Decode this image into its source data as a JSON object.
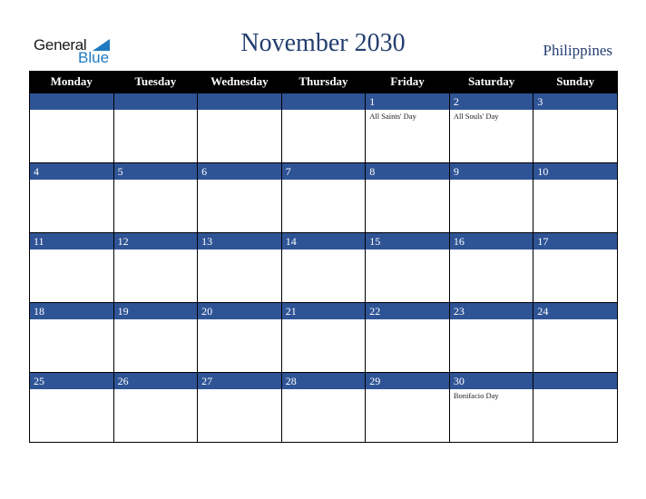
{
  "logo": {
    "general": "General",
    "blue": "Blue"
  },
  "header": {
    "title": "November 2030",
    "country": "Philippines"
  },
  "colors": {
    "band": "#2f5496",
    "header_bg": "#000000",
    "title": "#233e6f",
    "logo_blue": "#1f7ac0"
  },
  "weekdays": [
    "Monday",
    "Tuesday",
    "Wednesday",
    "Thursday",
    "Friday",
    "Saturday",
    "Sunday"
  ],
  "weeks": [
    [
      {
        "day": "",
        "holiday": ""
      },
      {
        "day": "",
        "holiday": ""
      },
      {
        "day": "",
        "holiday": ""
      },
      {
        "day": "",
        "holiday": ""
      },
      {
        "day": "1",
        "holiday": "All Saints' Day"
      },
      {
        "day": "2",
        "holiday": "All Souls' Day"
      },
      {
        "day": "3",
        "holiday": ""
      }
    ],
    [
      {
        "day": "4",
        "holiday": ""
      },
      {
        "day": "5",
        "holiday": ""
      },
      {
        "day": "6",
        "holiday": ""
      },
      {
        "day": "7",
        "holiday": ""
      },
      {
        "day": "8",
        "holiday": ""
      },
      {
        "day": "9",
        "holiday": ""
      },
      {
        "day": "10",
        "holiday": ""
      }
    ],
    [
      {
        "day": "11",
        "holiday": ""
      },
      {
        "day": "12",
        "holiday": ""
      },
      {
        "day": "13",
        "holiday": ""
      },
      {
        "day": "14",
        "holiday": ""
      },
      {
        "day": "15",
        "holiday": ""
      },
      {
        "day": "16",
        "holiday": ""
      },
      {
        "day": "17",
        "holiday": ""
      }
    ],
    [
      {
        "day": "18",
        "holiday": ""
      },
      {
        "day": "19",
        "holiday": ""
      },
      {
        "day": "20",
        "holiday": ""
      },
      {
        "day": "21",
        "holiday": ""
      },
      {
        "day": "22",
        "holiday": ""
      },
      {
        "day": "23",
        "holiday": ""
      },
      {
        "day": "24",
        "holiday": ""
      }
    ],
    [
      {
        "day": "25",
        "holiday": ""
      },
      {
        "day": "26",
        "holiday": ""
      },
      {
        "day": "27",
        "holiday": ""
      },
      {
        "day": "28",
        "holiday": ""
      },
      {
        "day": "29",
        "holiday": ""
      },
      {
        "day": "30",
        "holiday": "Bonifacio Day"
      },
      {
        "day": "",
        "holiday": ""
      }
    ]
  ]
}
